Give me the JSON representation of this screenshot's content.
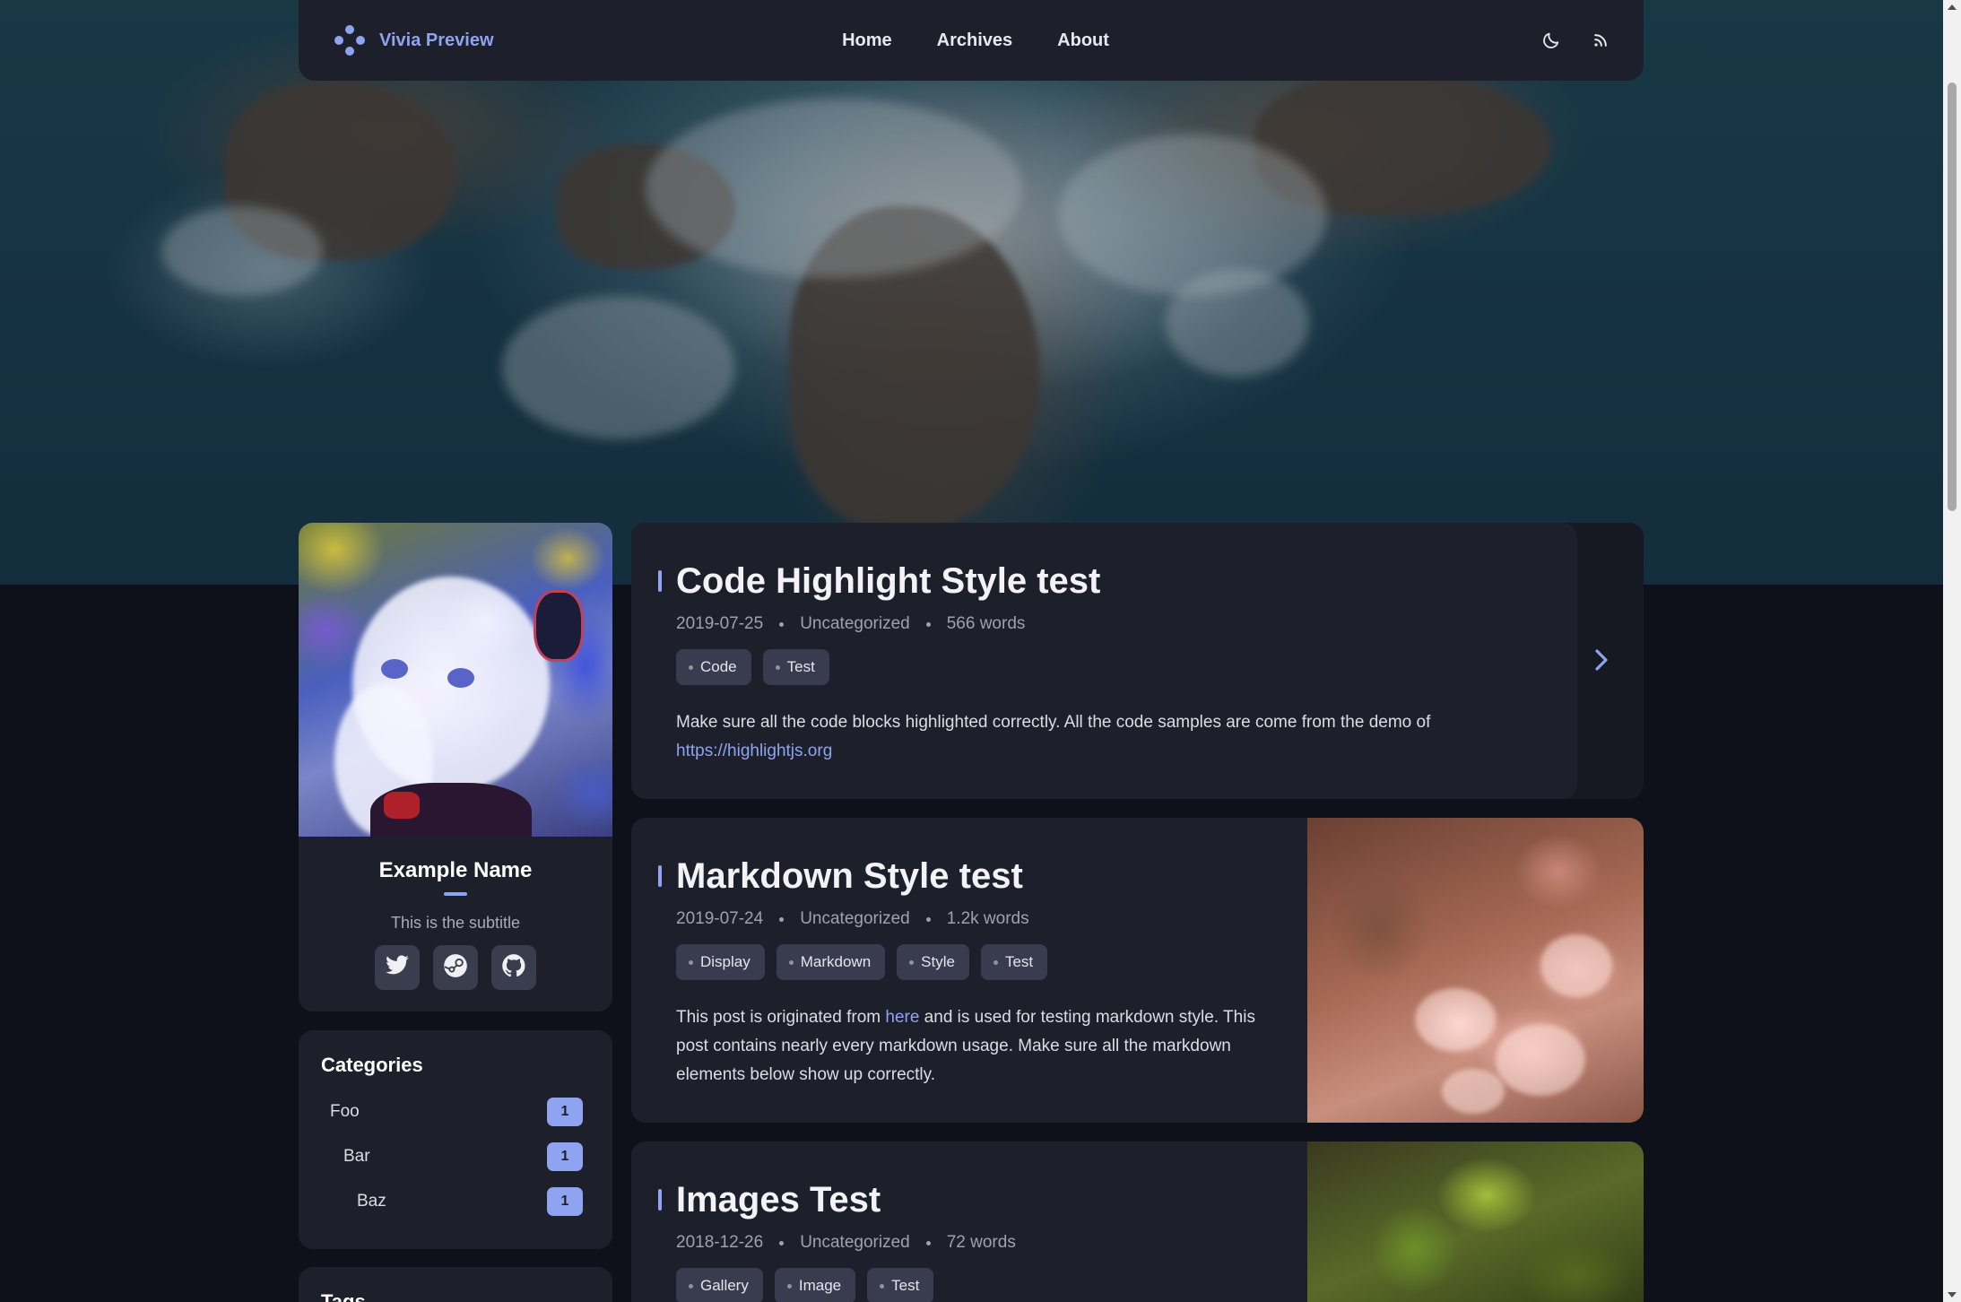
{
  "navbar": {
    "brand_title": "Vivia Preview",
    "brand_icon": "dots-logo-icon",
    "links": [
      {
        "label": "Home"
      },
      {
        "label": "Archives"
      },
      {
        "label": "About"
      }
    ],
    "icons": [
      "moon-icon",
      "rss-icon"
    ]
  },
  "profile": {
    "name": "Example Name",
    "subtitle": "This is the subtitle",
    "socials": [
      "twitter-icon",
      "steam-icon",
      "github-icon"
    ]
  },
  "categories": {
    "title": "Categories",
    "items": [
      {
        "name": "Foo",
        "count": "1"
      },
      {
        "name": "Bar",
        "count": "1"
      },
      {
        "name": "Baz",
        "count": "1"
      }
    ]
  },
  "tags_card": {
    "title": "Tags"
  },
  "posts": [
    {
      "title": "Code Highlight Style test",
      "date": "2019-07-25",
      "category": "Uncategorized",
      "words": "566 words",
      "tags": [
        "Code",
        "Test"
      ],
      "excerpt_before": "Make sure all the code blocks highlighted correctly. All the code samples are come from the demo of ",
      "excerpt_link": "https://highlightjs.org"
    },
    {
      "title": "Markdown Style test",
      "date": "2019-07-24",
      "category": "Uncategorized",
      "words": "1.2k words",
      "tags": [
        "Display",
        "Markdown",
        "Style",
        "Test"
      ],
      "excerpt_before": "This post is originated from ",
      "excerpt_link": "here",
      "excerpt_after": " and is used for testing markdown style. This post contains nearly every markdown usage. Make sure all the markdown elements below show up correctly."
    },
    {
      "title": "Images Test",
      "date": "2018-12-26",
      "category": "Uncategorized",
      "words": "72 words",
      "tags": [
        "Gallery",
        "Image",
        "Test"
      ]
    }
  ],
  "colors": {
    "accent": "#8ea4f0",
    "card_bg": "#1d1f2b",
    "page_bg": "#0f111a",
    "tag_bg": "#393c4e"
  }
}
